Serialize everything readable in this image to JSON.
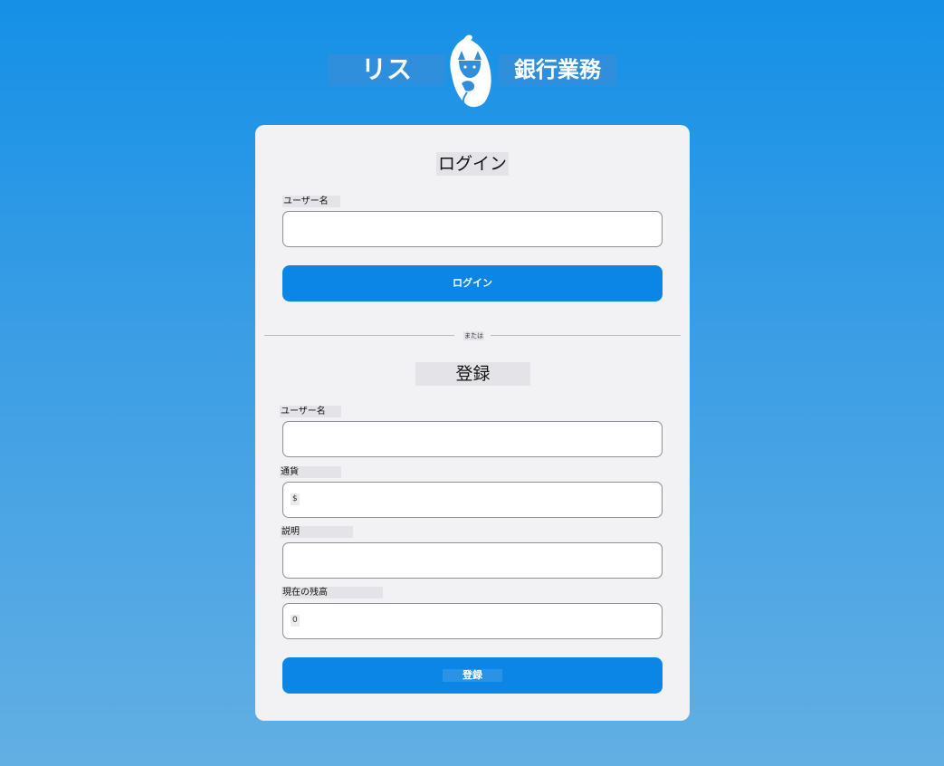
{
  "header": {
    "brand_left": "リス",
    "brand_right": "銀行業務"
  },
  "colors": {
    "accent": "#0b85e6",
    "card_background": "#f2f2f4"
  },
  "login": {
    "title": "ログイン",
    "username_label": "ユーザー名",
    "username_value": "",
    "button_label": "ログイン"
  },
  "divider": {
    "text": "または"
  },
  "register": {
    "title": "登録",
    "username_label": "ユーザー名",
    "username_value": "",
    "currency_label": "通貨",
    "currency_value": "$",
    "description_label": "説明",
    "description_value": "",
    "balance_label": "現在の残高",
    "balance_value": "0",
    "button_label": "登録"
  }
}
